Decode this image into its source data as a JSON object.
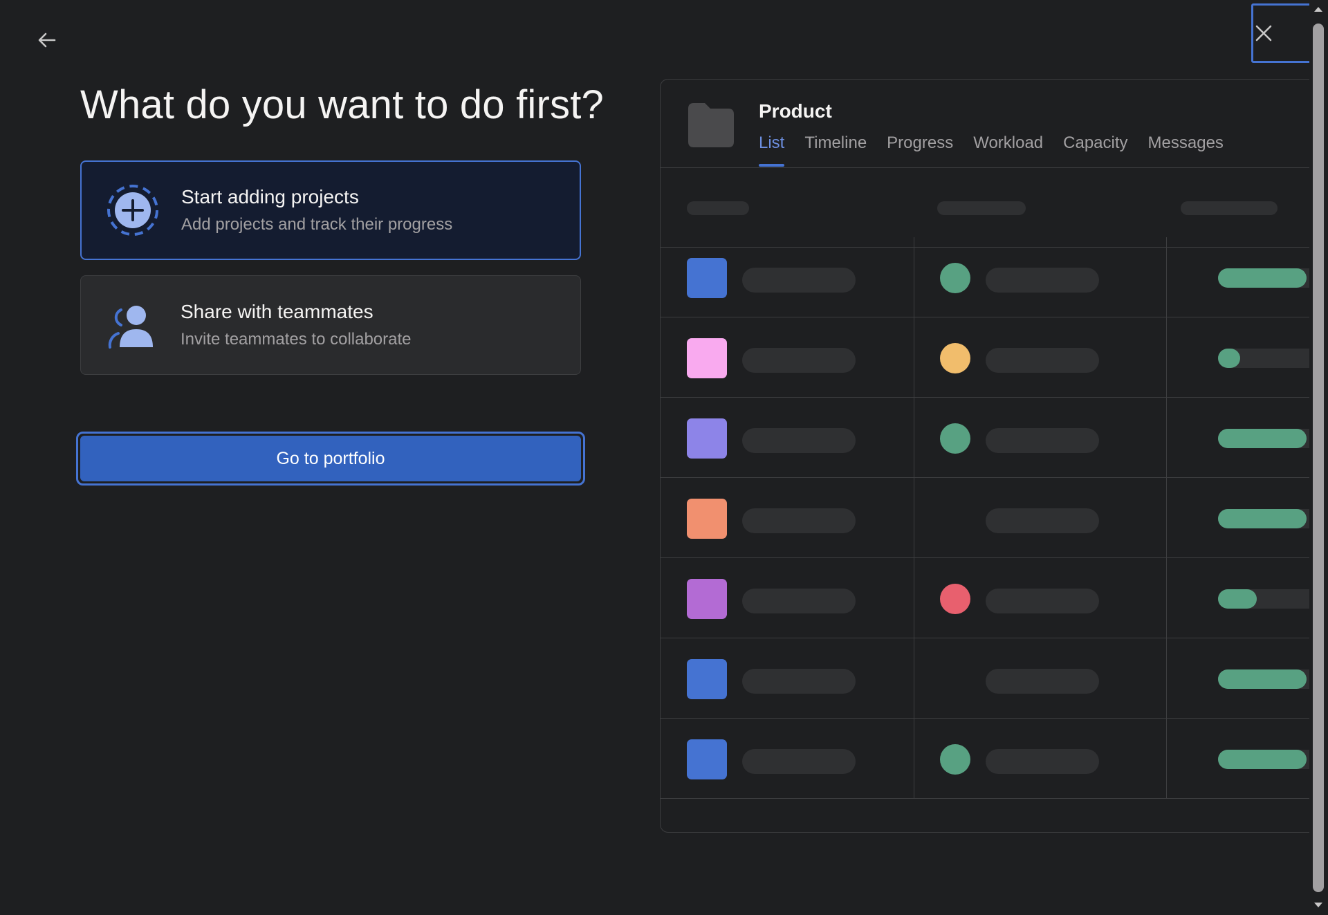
{
  "heading": "What do you want to do first?",
  "options": [
    {
      "title": "Start adding projects",
      "subtitle": "Add projects and track their progress",
      "icon": "add-circle-icon",
      "selected": true
    },
    {
      "title": "Share with teammates",
      "subtitle": "Invite teammates to collaborate",
      "icon": "teammates-icon",
      "selected": false
    }
  ],
  "primary_button": "Go to portfolio",
  "preview": {
    "project_name": "Product",
    "tabs": [
      "List",
      "Timeline",
      "Progress",
      "Workload",
      "Capacity",
      "Messages"
    ],
    "active_tab": "List",
    "rows": [
      {
        "swatch_color": "#4573d2",
        "status_color": "#58a182",
        "progress": 0.8
      },
      {
        "swatch_color": "#f9aaef",
        "status_color": "#f1bd6c",
        "progress": 0.2
      },
      {
        "swatch_color": "#8d84e8",
        "status_color": "#58a182",
        "progress": 0.8
      },
      {
        "swatch_color": "#f1906f",
        "status_color": null,
        "progress": 0.8
      },
      {
        "swatch_color": "#b36bd4",
        "status_color": "#e8606e",
        "progress": 0.35
      },
      {
        "swatch_color": "#4573d2",
        "status_color": null,
        "progress": 0.8
      },
      {
        "swatch_color": "#4573d2",
        "status_color": "#58a182",
        "progress": 0.8
      }
    ]
  },
  "colors": {
    "background": "#1e1f21",
    "accent": "#4573d2",
    "primary_button": "#3262be"
  }
}
